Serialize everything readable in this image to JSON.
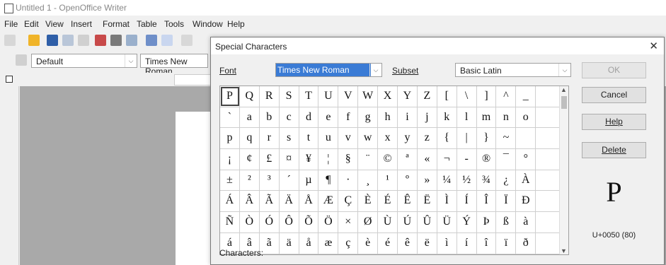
{
  "app": {
    "title": "Untitled 1 - OpenOffice Writer",
    "menu": [
      "File",
      "Edit",
      "View",
      "Insert",
      "Format",
      "Table",
      "Tools",
      "Window",
      "Help"
    ],
    "style_value": "Default",
    "font_value": "Times New Roman"
  },
  "dialog": {
    "title": "Special Characters",
    "font_label": "Font",
    "font_value": "Times New Roman",
    "subset_label": "Subset",
    "subset_value": "Basic Latin",
    "buttons": {
      "ok": "OK",
      "cancel": "Cancel",
      "help": "Help",
      "delete": "Delete"
    },
    "preview_char": "P",
    "preview_code": "U+0050 (80)",
    "characters_label": "Characters:",
    "grid": [
      [
        "P",
        "Q",
        "R",
        "S",
        "T",
        "U",
        "V",
        "W",
        "X",
        "Y",
        "Z",
        "[",
        "\\",
        "]",
        "^",
        "_"
      ],
      [
        "`",
        "a",
        "b",
        "c",
        "d",
        "e",
        "f",
        "g",
        "h",
        "i",
        "j",
        "k",
        "l",
        "m",
        "n",
        "o"
      ],
      [
        "p",
        "q",
        "r",
        "s",
        "t",
        "u",
        "v",
        "w",
        "x",
        "y",
        "z",
        "{",
        "|",
        "}",
        "~",
        ""
      ],
      [
        "¡",
        "¢",
        "£",
        "¤",
        "¥",
        "¦",
        "§",
        "¨",
        "©",
        "ª",
        "«",
        "¬",
        "-",
        "®",
        "¯",
        "°"
      ],
      [
        "±",
        "²",
        "³",
        "´",
        "µ",
        "¶",
        "·",
        "¸",
        "¹",
        "º",
        "»",
        "¼",
        "½",
        "¾",
        "¿",
        "À"
      ],
      [
        "Á",
        "Â",
        "Ã",
        "Ä",
        "Å",
        "Æ",
        "Ç",
        "È",
        "É",
        "Ê",
        "Ë",
        "Ì",
        "Í",
        "Î",
        "Ï",
        "Đ"
      ],
      [
        "Ñ",
        "Ò",
        "Ó",
        "Ô",
        "Õ",
        "Ö",
        "×",
        "Ø",
        "Ù",
        "Ú",
        "Û",
        "Ü",
        "Ý",
        "Þ",
        "ß",
        "à"
      ],
      [
        "á",
        "â",
        "ã",
        "ä",
        "å",
        "æ",
        "ç",
        "è",
        "é",
        "ê",
        "ë",
        "ì",
        "í",
        "î",
        "ï",
        "ð"
      ]
    ],
    "selected": "P"
  }
}
